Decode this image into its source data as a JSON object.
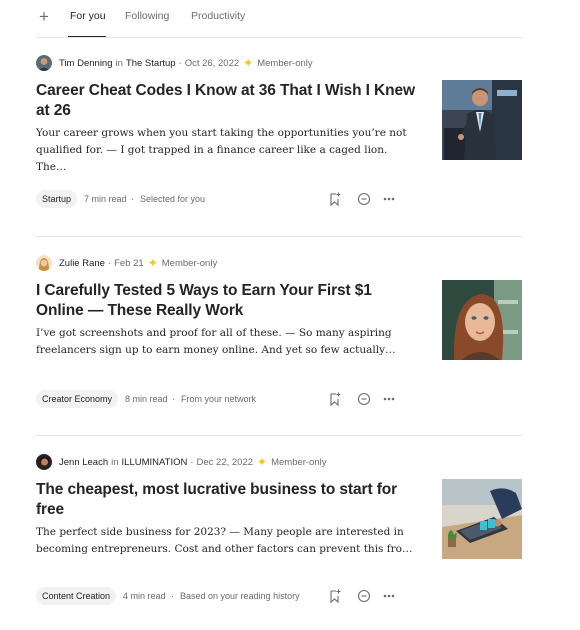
{
  "tabs": {
    "plus_icon": "plus-icon",
    "items": [
      "For you",
      "Following",
      "Productivity"
    ],
    "active": "For you"
  },
  "colors": {
    "member_star": "#ffc017",
    "muted_text": "#6b6b6b",
    "chip_bg": "#f2f2f2",
    "divider": "#e6e6e6"
  },
  "articles": [
    {
      "author": "Tim Denning",
      "in_label": "in",
      "publication": "The Startup",
      "date": "Oct 26, 2022",
      "member": "Member-only",
      "title": "Career Cheat Codes I Know at 36 That I Wish I Knew at 26",
      "excerpt": "Your career grows when you start taking the opportunities you’re not qualified for. — I got trapped in a finance career like a caged lion. The…",
      "tag": "Startup",
      "read_time": "7 min read",
      "reason": "Selected for you"
    },
    {
      "author": "Zulie Rane",
      "in_label": "",
      "publication": "",
      "date": "Feb 21",
      "member": "Member-only",
      "title": "I Carefully Tested 5 Ways to Earn Your First $1 Online — These Really Work",
      "excerpt": "I’ve got screenshots and proof for all of these. — So many aspiring freelancers sign up to earn money online. And yet so few actually…",
      "tag": "Creator Economy",
      "read_time": "8 min read",
      "reason": "From your network"
    },
    {
      "author": "Jenn Leach",
      "in_label": "in",
      "publication": "ILLUMINATION",
      "date": "Dec 22, 2022",
      "member": "Member-only",
      "title": "The cheapest, most lucrative business to start for free",
      "excerpt": "The perfect side business for 2023? — Many people are interested in becoming entrepreneurs. Cost and other factors can prevent this fro…",
      "tag": "Content Creation",
      "read_time": "4 min read",
      "reason": "Based on your reading history"
    }
  ],
  "separator": "·",
  "icons": {
    "member": "star-icon",
    "save": "bookmark-add-icon",
    "show_less": "minus-circle-icon",
    "more": "more-dots-icon"
  }
}
